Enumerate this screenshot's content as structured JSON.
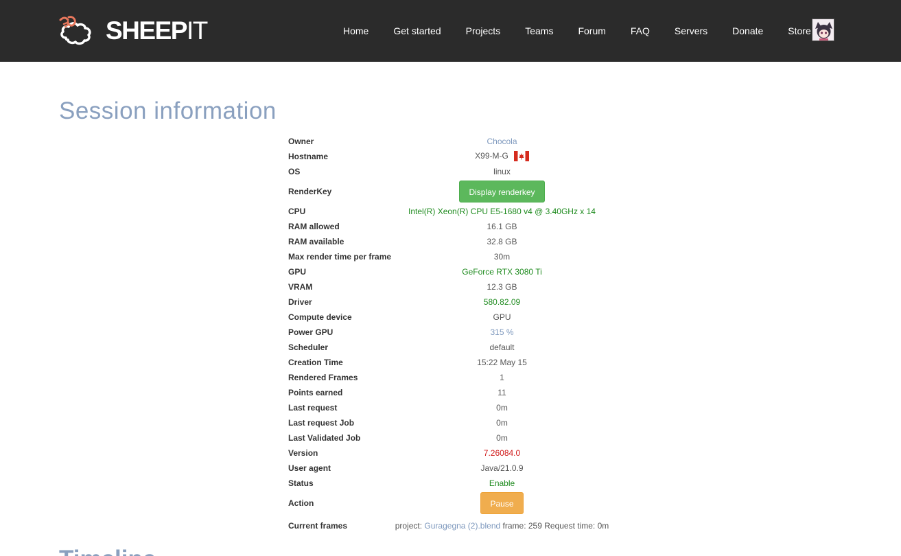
{
  "brand": {
    "name_bold": "SHEEP",
    "name_light": "IT"
  },
  "nav": {
    "items": [
      {
        "key": "home",
        "label": "Home"
      },
      {
        "key": "get-started",
        "label": "Get started"
      },
      {
        "key": "projects",
        "label": "Projects"
      },
      {
        "key": "teams",
        "label": "Teams"
      },
      {
        "key": "forum",
        "label": "Forum"
      },
      {
        "key": "faq",
        "label": "FAQ"
      },
      {
        "key": "servers",
        "label": "Servers"
      },
      {
        "key": "donate",
        "label": "Donate"
      },
      {
        "key": "store",
        "label": "Store"
      }
    ]
  },
  "page": {
    "title": "Session information",
    "next_section_title": "Timeline"
  },
  "session": {
    "owner": {
      "label": "Owner",
      "value": "Chocola"
    },
    "hostname": {
      "label": "Hostname",
      "value": "X99-M-G",
      "flag_icon": "canada-flag-icon"
    },
    "os": {
      "label": "OS",
      "value": "linux"
    },
    "renderkey": {
      "label": "RenderKey",
      "button": "Display renderkey"
    },
    "cpu": {
      "label": "CPU",
      "value": "Intel(R) Xeon(R) CPU E5-1680 v4 @ 3.40GHz x 14"
    },
    "ram_allowed": {
      "label": "RAM allowed",
      "value": "16.1 GB"
    },
    "ram_available": {
      "label": "RAM available",
      "value": "32.8 GB"
    },
    "max_render_time": {
      "label": "Max render time per frame",
      "value": "30m"
    },
    "gpu": {
      "label": "GPU",
      "value": "GeForce RTX 3080 Ti"
    },
    "vram": {
      "label": "VRAM",
      "value": "12.3 GB"
    },
    "driver": {
      "label": "Driver",
      "value": "580.82.09"
    },
    "compute_device": {
      "label": "Compute device",
      "value": "GPU"
    },
    "power_gpu": {
      "label": "Power GPU",
      "value": "315 %"
    },
    "scheduler": {
      "label": "Scheduler",
      "value": "default"
    },
    "creation_time": {
      "label": "Creation Time",
      "value": "15:22 May 15"
    },
    "rendered_frames": {
      "label": "Rendered Frames",
      "value": "1"
    },
    "points_earned": {
      "label": "Points earned",
      "value": "11"
    },
    "last_request": {
      "label": "Last request",
      "value": "0m"
    },
    "last_request_job": {
      "label": "Last request Job",
      "value": "0m"
    },
    "last_validated_job": {
      "label": "Last Validated Job",
      "value": "0m"
    },
    "version": {
      "label": "Version",
      "value": "7.26084.0"
    },
    "user_agent": {
      "label": "User agent",
      "value": "Java/21.0.9"
    },
    "status": {
      "label": "Status",
      "value": "Enable"
    },
    "action": {
      "label": "Action",
      "button": "Pause"
    },
    "current_frames": {
      "label": "Current frames",
      "project_prefix": "project:",
      "project_name": "Guragegna (2).blend",
      "frame_text": "frame: 259",
      "request_time_text": "Request time: 0m"
    }
  },
  "colors": {
    "navbar_bg": "#2b2b2b",
    "title": "#8aa0bf",
    "link": "#7d98bd",
    "green_text": "#1f8b1f",
    "red_text": "#d01818",
    "button_green": "#5cb85c",
    "button_orange": "#f0ad4e"
  }
}
